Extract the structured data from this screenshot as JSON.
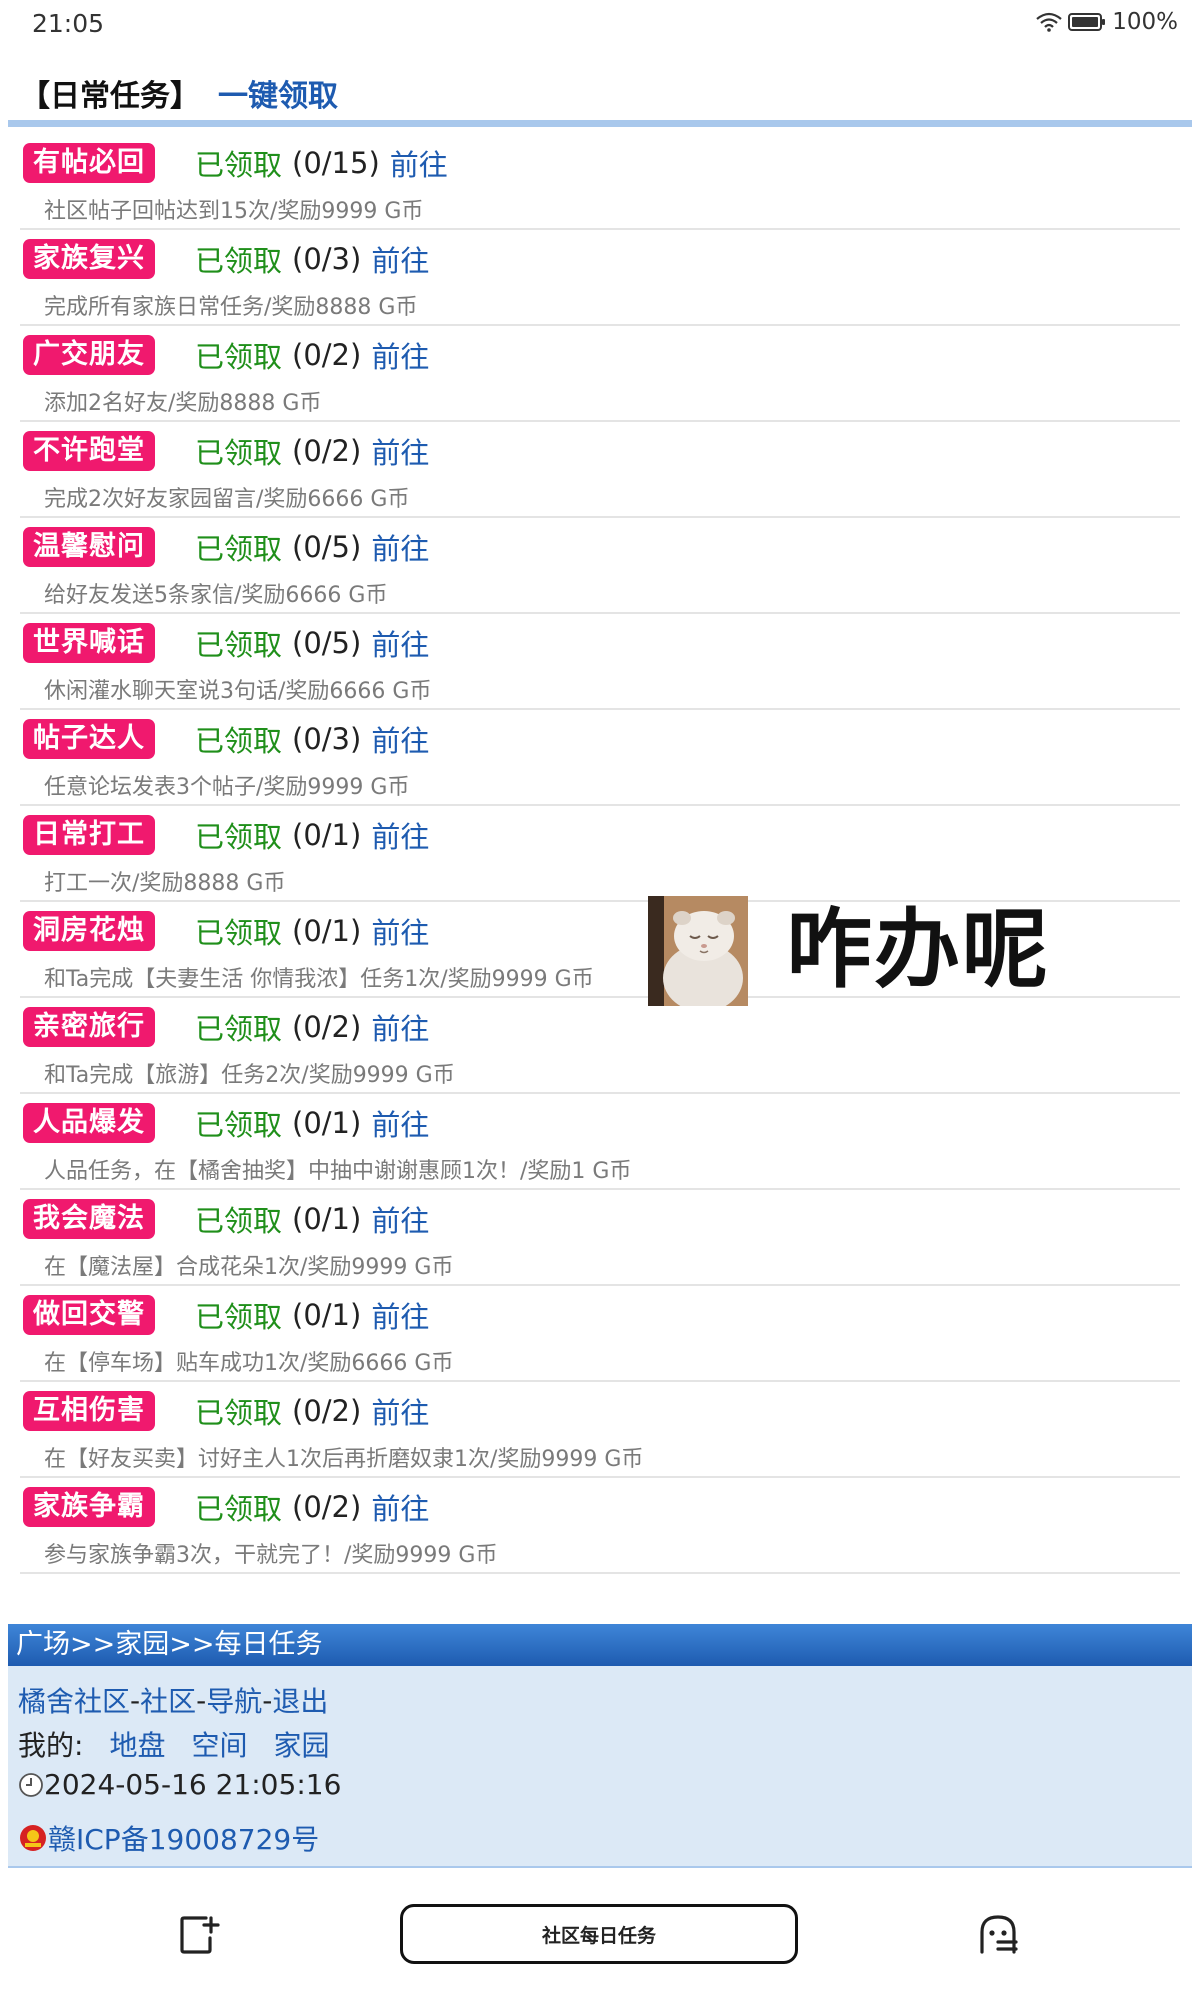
{
  "status": {
    "time": "21:05",
    "battery": "100%"
  },
  "header": {
    "title": "【日常任务】",
    "claim_all": "一键领取"
  },
  "tasks": [
    {
      "name": "有帖必回",
      "status": "已领取",
      "progress": "(0/15)",
      "go": "前往",
      "desc": "社区帖子回帖达到15次/奖励9999 G币"
    },
    {
      "name": "家族复兴",
      "status": "已领取",
      "progress": "(0/3)",
      "go": "前往",
      "desc": "完成所有家族日常任务/奖励8888 G币"
    },
    {
      "name": "广交朋友",
      "status": "已领取",
      "progress": "(0/2)",
      "go": "前往",
      "desc": "添加2名好友/奖励8888 G币"
    },
    {
      "name": "不许跑堂",
      "status": "已领取",
      "progress": "(0/2)",
      "go": "前往",
      "desc": "完成2次好友家园留言/奖励6666 G币"
    },
    {
      "name": "温馨慰问",
      "status": "已领取",
      "progress": "(0/5)",
      "go": "前往",
      "desc": "给好友发送5条家信/奖励6666 G币"
    },
    {
      "name": "世界喊话",
      "status": "已领取",
      "progress": "(0/5)",
      "go": "前往",
      "desc": "休闲灌水聊天室说3句话/奖励6666 G币"
    },
    {
      "name": "帖子达人",
      "status": "已领取",
      "progress": "(0/3)",
      "go": "前往",
      "desc": "任意论坛发表3个帖子/奖励9999 G币"
    },
    {
      "name": "日常打工",
      "status": "已领取",
      "progress": "(0/1)",
      "go": "前往",
      "desc": "打工一次/奖励8888 G币"
    },
    {
      "name": "洞房花烛",
      "status": "已领取",
      "progress": "(0/1)",
      "go": "前往",
      "desc": "和Ta完成【夫妻生活 你情我浓】任务1次/奖励9999 G币"
    },
    {
      "name": "亲密旅行",
      "status": "已领取",
      "progress": "(0/2)",
      "go": "前往",
      "desc": "和Ta完成【旅游】任务2次/奖励9999 G币"
    },
    {
      "name": "人品爆发",
      "status": "已领取",
      "progress": "(0/1)",
      "go": "前往",
      "desc": "人品任务，在【橘舍抽奖】中抽中谢谢惠顾1次！/奖励1 G币"
    },
    {
      "name": "我会魔法",
      "status": "已领取",
      "progress": "(0/1)",
      "go": "前往",
      "desc": "在【魔法屋】合成花朵1次/奖励9999 G币"
    },
    {
      "name": "做回交警",
      "status": "已领取",
      "progress": "(0/1)",
      "go": "前往",
      "desc": "在【停车场】贴车成功1次/奖励6666 G币"
    },
    {
      "name": "互相伤害",
      "status": "已领取",
      "progress": "(0/2)",
      "go": "前往",
      "desc": "在【好友买卖】讨好主人1次后再折磨奴隶1次/奖励9999 G币"
    },
    {
      "name": "家族争霸",
      "status": "已领取",
      "progress": "(0/2)",
      "go": "前往",
      "desc": "参与家族争霸3次，干就完了！/奖励9999 G币"
    }
  ],
  "sticker": {
    "text": "咋办呢"
  },
  "footer": {
    "breadcrumb": "广场>>家园>>每日任务",
    "nav": [
      "橘舍社区",
      "社区",
      "导航",
      "退出"
    ],
    "nav_sep": "-",
    "my_label": "我的:",
    "my_links": [
      "地盘",
      "空间",
      "家园"
    ],
    "datetime": "2024-05-16 21:05:16",
    "icp": "赣ICP备19008729号"
  },
  "bottom_nav": {
    "center_label": "社区每日任务"
  }
}
